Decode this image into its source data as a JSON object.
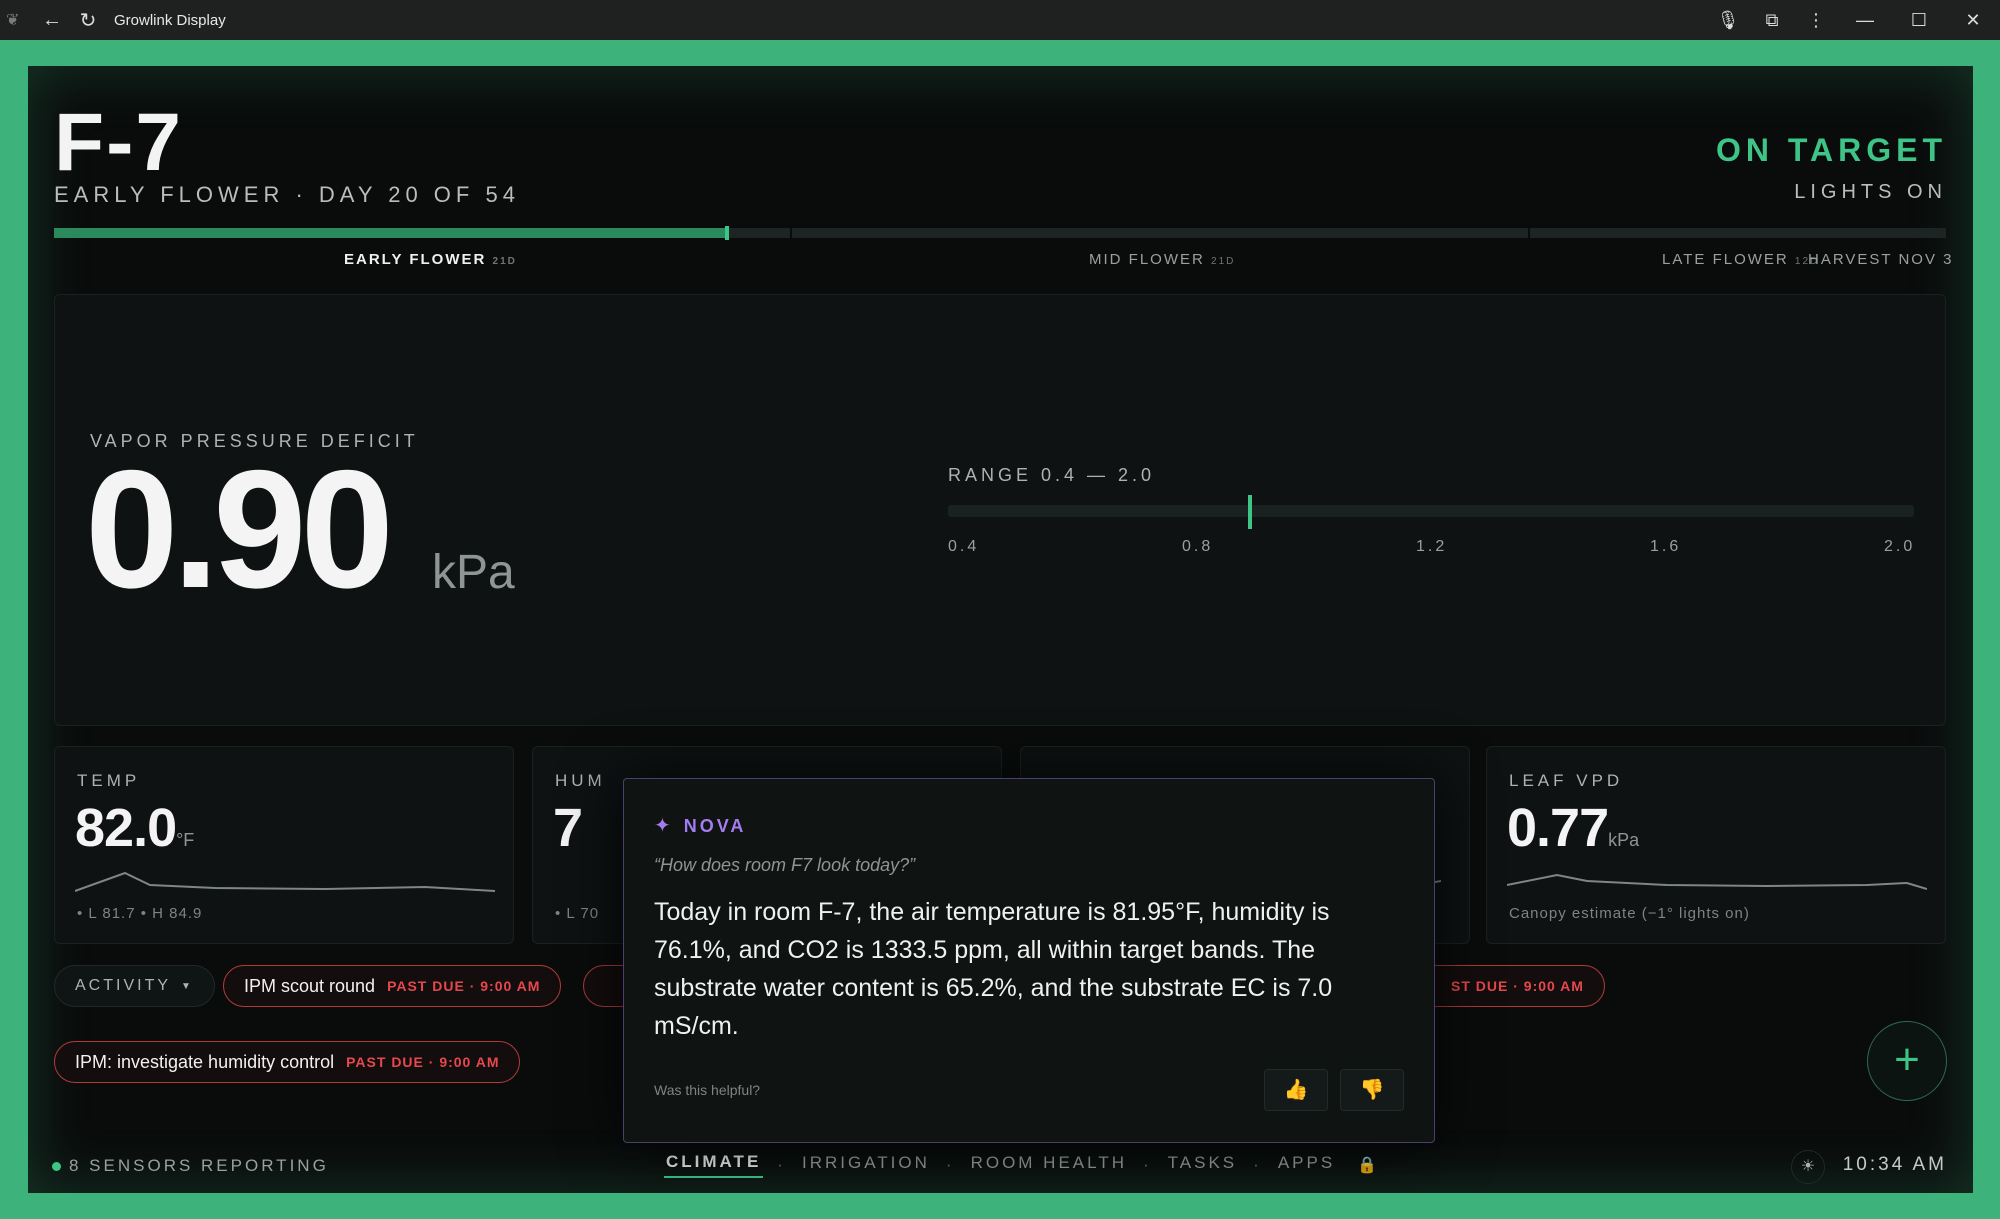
{
  "browser": {
    "title": "Growlink Display",
    "icons": [
      "leaf-icon",
      "back-arrow-icon",
      "reload-icon",
      "microphone-icon",
      "extension-icon",
      "menu-icon",
      "minimize-icon",
      "maximize-icon",
      "close-icon"
    ]
  },
  "header": {
    "room": "F-7",
    "stage_line": "EARLY FLOWER · DAY 20 OF 54",
    "status": "ON TARGET",
    "lights": "LIGHTS ON"
  },
  "timeline": {
    "progress": 0.37,
    "stages": [
      {
        "label": "EARLY FLOWER",
        "days": "21D"
      },
      {
        "label": "MID FLOWER",
        "days": "21D"
      },
      {
        "label": "LATE FLOWER",
        "days": "12D"
      }
    ],
    "harvest": "HARVEST NOV 3"
  },
  "vpd": {
    "label": "VAPOR PRESSURE DEFICIT",
    "value": "0.90",
    "unit": "kPa",
    "range_label": "RANGE 0.4 — 2.0",
    "range_min": 0.4,
    "range_max": 2.0,
    "current": 0.9,
    "ticks": [
      "0.4",
      "0.8",
      "1.2",
      "1.6",
      "2.0"
    ]
  },
  "cards": {
    "temp": {
      "label": "TEMP",
      "value": "82.0",
      "unit": "°F",
      "foot": "• L 81.7 • H 84.9"
    },
    "humidity": {
      "label": "HUM",
      "value": "7",
      "foot": "• L 70"
    },
    "leaf_vpd": {
      "label": "LEAF VPD",
      "value": "0.77",
      "unit": "kPa",
      "foot": "Canopy estimate (−1° lights on)"
    }
  },
  "activity": {
    "label": "ACTIVITY",
    "tasks": [
      {
        "title": "IPM scout round",
        "due": "PAST DUE · 9:00 AM"
      },
      {
        "title": "",
        "due": "ST DUE · 9:00 AM"
      },
      {
        "title": "IPM: investigate humidity control",
        "due": "PAST DUE · 9:00 AM"
      }
    ]
  },
  "fab": {
    "symbol": "+"
  },
  "footer": {
    "sensors": "8 SENSORS REPORTING",
    "tabs": [
      "CLIMATE",
      "IRRIGATION",
      "ROOM HEALTH",
      "TASKS",
      "APPS"
    ],
    "active_tab": "CLIMATE",
    "time": "10:34 AM"
  },
  "nova": {
    "title": "NOVA",
    "query": "“How does room F7 look today?”",
    "answer": "Today in room F-7, the air temperature is 81.95°F, humidity is 76.1%, and CO2 is 1333.5 ppm, all within target bands. The substrate water content is 65.2%, and the substrate EC is 7.0 mS/cm.",
    "helpful": "Was this helpful?"
  },
  "colors": {
    "accent": "#3fc487",
    "frame": "#3db37b",
    "alert": "#e5484d",
    "nova": "#a57cf0"
  }
}
